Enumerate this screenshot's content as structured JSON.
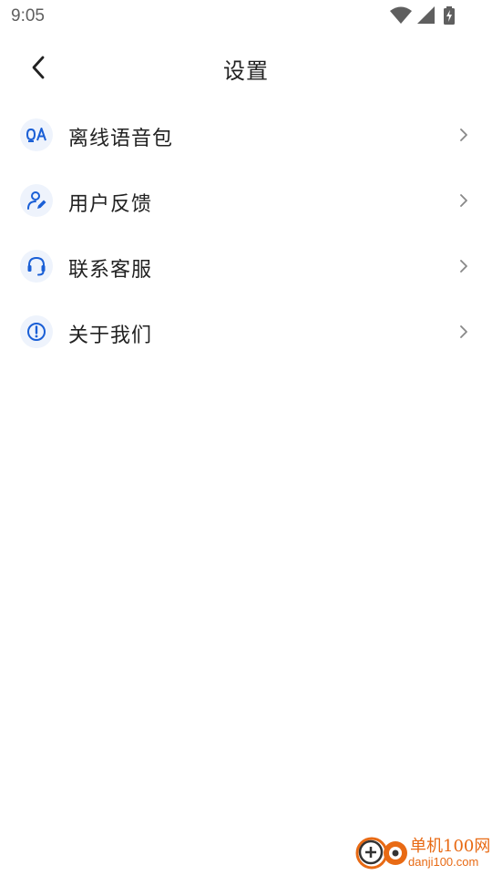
{
  "status_bar": {
    "time": "9:05",
    "icons": [
      "wifi-icon",
      "cell-signal-icon",
      "battery-charging-icon"
    ]
  },
  "header": {
    "title": "设置",
    "back_icon": "back-arrow-icon"
  },
  "menu": {
    "items": [
      {
        "label": "离线语音包",
        "icon": "offline-voice-pack-icon"
      },
      {
        "label": "用户反馈",
        "icon": "user-feedback-icon"
      },
      {
        "label": "联系客服",
        "icon": "headset-icon"
      },
      {
        "label": "关于我们",
        "icon": "info-icon"
      }
    ],
    "chevron_icon": "chevron-right-icon"
  },
  "watermark": {
    "name": "单机100网",
    "url": "danji100.com"
  },
  "colors": {
    "accent": "#1a5fd6",
    "icon_bg": "#eef3fc",
    "text": "#222222",
    "chevron": "#888888",
    "watermark": "#e86a14"
  }
}
